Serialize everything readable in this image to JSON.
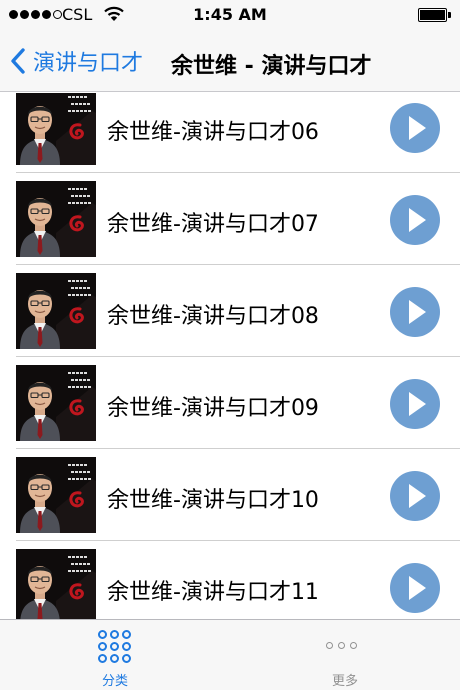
{
  "status_bar": {
    "carrier": "CSL",
    "time": "1:45 AM",
    "signal_bars_filled": 4,
    "signal_bars_total": 5,
    "battery_level": 1.0
  },
  "nav": {
    "back_label": "演讲与口才",
    "title": "余世维 - 演讲与口才"
  },
  "list": {
    "items": [
      {
        "title": "余世维-演讲与口才06"
      },
      {
        "title": "余世维-演讲与口才07"
      },
      {
        "title": "余世维-演讲与口才08"
      },
      {
        "title": "余世维-演讲与口才09"
      },
      {
        "title": "余世维-演讲与口才10"
      },
      {
        "title": "余世维-演讲与口才11"
      }
    ]
  },
  "tabs": [
    {
      "label": "分类",
      "icon": "grid-icon",
      "active": true
    },
    {
      "label": "更多",
      "icon": "more-icon",
      "active": false
    }
  ],
  "colors": {
    "accent": "#1f7ae0",
    "play_button": "#6e9fd2",
    "inactive_tab": "#929292"
  }
}
